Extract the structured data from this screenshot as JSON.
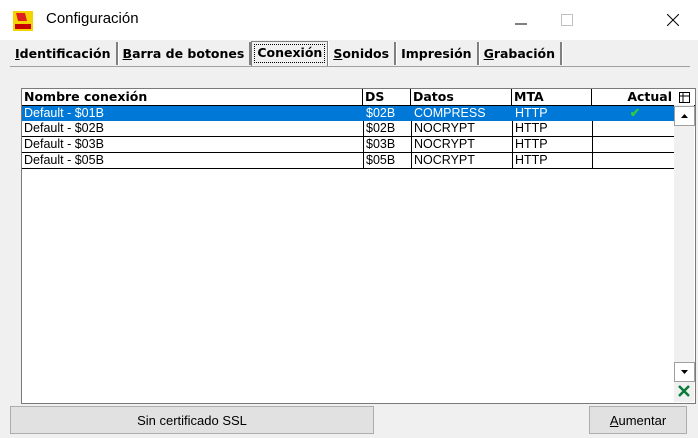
{
  "window": {
    "title": "Configuración"
  },
  "tabs": [
    {
      "label": "Identificación",
      "accel": "I",
      "rest": "dentificación"
    },
    {
      "label": "Barra de botones",
      "accel": "B",
      "rest": "arra de botones"
    },
    {
      "label": "Conexión",
      "accel": "",
      "rest": "Conexión",
      "active": true
    },
    {
      "label": "Sonidos",
      "accel": "S",
      "rest": "onidos"
    },
    {
      "label": "Impresión",
      "accel": "",
      "rest": "Impresión"
    },
    {
      "label": "Grabación",
      "accel": "G",
      "rest": "rabación"
    }
  ],
  "grid": {
    "columns": [
      "Nombre conexión",
      "DS",
      "Datos",
      "MTA",
      "Actual"
    ],
    "rows": [
      {
        "name": "Default - $01B",
        "ds": "$02B",
        "datos": "COMPRESS",
        "mta": "HTTP",
        "actual": "✔",
        "selected": true
      },
      {
        "name": "Default - $02B",
        "ds": "$02B",
        "datos": "NOCRYPT",
        "mta": "HTTP",
        "actual": ""
      },
      {
        "name": "Default - $03B",
        "ds": "$03B",
        "datos": "NOCRYPT",
        "mta": "HTTP",
        "actual": ""
      },
      {
        "name": "Default - $05B",
        "ds": "$05B",
        "datos": "NOCRYPT",
        "mta": "HTTP",
        "actual": ""
      }
    ]
  },
  "buttons": {
    "ssl": "Sin certificado SSL",
    "add_accel": "A",
    "add_rest": "umentar"
  },
  "icons": {
    "app": "set-app-icon",
    "check": "check-icon",
    "excel": "excel-icon",
    "column_chooser": "column-chooser-icon"
  },
  "colors": {
    "selection": "#0078d7",
    "check": "#2ecc40"
  }
}
